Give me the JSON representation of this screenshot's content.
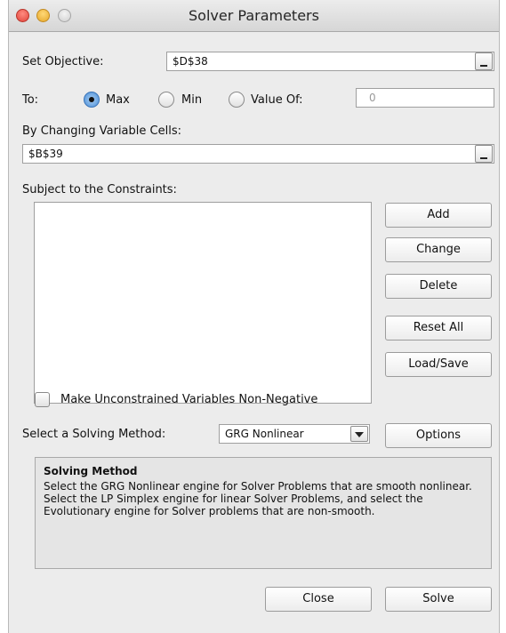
{
  "window": {
    "title": "Solver Parameters"
  },
  "objective": {
    "label": "Set Objective:",
    "value": "$D$38"
  },
  "to": {
    "label": "To:",
    "options": [
      "Max",
      "Min",
      "Value Of:"
    ],
    "selected": "Max",
    "value_of": "0"
  },
  "variables": {
    "label": "By Changing Variable Cells:",
    "value": "$B$39"
  },
  "constraints": {
    "label": "Subject to the Constraints:",
    "items": [],
    "buttons": {
      "add": "Add",
      "change": "Change",
      "delete": "Delete",
      "reset": "Reset All",
      "load_save": "Load/Save"
    }
  },
  "nonneg": {
    "label": "Make Unconstrained Variables Non-Negative",
    "checked": false
  },
  "method": {
    "label": "Select a Solving Method:",
    "value": "GRG Nonlinear",
    "options_button": "Options"
  },
  "info": {
    "heading": "Solving Method",
    "body": "Select the GRG Nonlinear engine for Solver Problems that are smooth nonlinear. Select the LP Simplex engine for linear Solver Problems, and select the Evolutionary engine for Solver problems that are non-smooth."
  },
  "footer": {
    "close": "Close",
    "solve": "Solve"
  },
  "colors": {
    "window_bg": "#ececec",
    "radio_selected": "#4b8fd7",
    "close": "#e0443a",
    "minimize": "#e6a72a",
    "zoom": "#cfcfcf"
  },
  "icons": {
    "close": "close-icon",
    "minimize": "minimize-icon",
    "zoom": "zoom-icon",
    "ref_button": "collapse-dialog-icon",
    "dropdown": "chevron-down-icon"
  }
}
